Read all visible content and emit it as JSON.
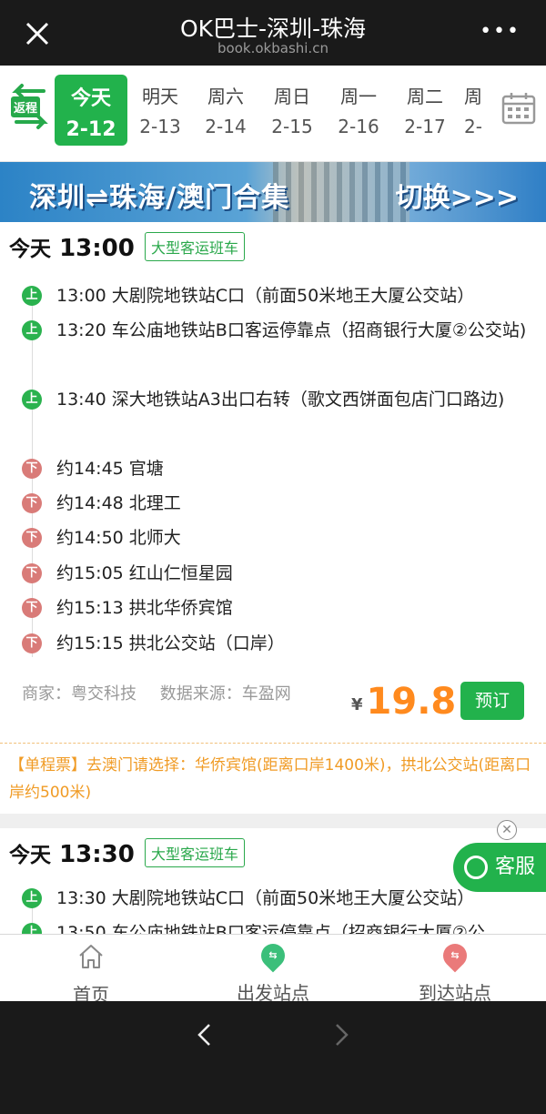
{
  "topbar": {
    "title": "OK巴士-深圳-珠海",
    "url": "book.okbashi.cn",
    "more": "•••"
  },
  "datebar": {
    "return_label": "返程",
    "days": [
      {
        "name": "今天",
        "date": "2-12",
        "active": true
      },
      {
        "name": "明天",
        "date": "2-13"
      },
      {
        "name": "周六",
        "date": "2-14"
      },
      {
        "name": "周日",
        "date": "2-15"
      },
      {
        "name": "周一",
        "date": "2-16"
      },
      {
        "name": "周二",
        "date": "2-17"
      },
      {
        "name": "周",
        "date": "2-"
      }
    ]
  },
  "banner": {
    "text": "深圳⇌珠海/澳门合集",
    "switch": "切换>>>"
  },
  "trips": [
    {
      "day": "今天",
      "time": "13:00",
      "tag": "大型客运班车",
      "stops": [
        {
          "type": "up",
          "icon": "上",
          "text": "13:00 大剧院地铁站C口（前面50米地王大厦公交站）"
        },
        {
          "type": "up",
          "icon": "上",
          "text": "13:20 车公庙地铁站B口客运停靠点（招商银行大厦②公交站)"
        },
        {
          "type": "up",
          "icon": "上",
          "text": "13:40 深大地铁站A3出口右转（歌文西饼面包店门口路边)"
        },
        {
          "type": "down",
          "icon": "下",
          "text": "约14:45 官塘"
        },
        {
          "type": "down",
          "icon": "下",
          "text": "约14:48 北理工"
        },
        {
          "type": "down",
          "icon": "下",
          "text": "约14:50 北师大"
        },
        {
          "type": "down",
          "icon": "下",
          "text": "约15:05 红山仁恒星园"
        },
        {
          "type": "down",
          "icon": "下",
          "text": "约15:13 拱北华侨宾馆"
        },
        {
          "type": "down",
          "icon": "下",
          "text": "约15:15 拱北公交站（口岸）"
        }
      ],
      "merchant": "商家：粤交科技",
      "source": "数据来源：车盈网",
      "currency": "¥",
      "price": "19.8",
      "book_label": "预订",
      "note": "【单程票】去澳门请选择：华侨宾馆(距离口岸1400米)，拱北公交站(距离口岸约500米)"
    },
    {
      "day": "今天",
      "time": "13:30",
      "tag": "大型客运班车",
      "stops": [
        {
          "type": "up",
          "icon": "上",
          "text": "13:30 大剧院地铁站C口（前面50米地王大厦公交站）"
        },
        {
          "type": "up",
          "icon": "上",
          "text": "13:50 车公庙地铁站B口客运停靠点（招商银行大厦②公"
        }
      ]
    }
  ],
  "float": {
    "close": "✕",
    "service_label": "客服"
  },
  "bottomnav": {
    "items": [
      {
        "label": "首页",
        "icon": "home-icon"
      },
      {
        "label": "出发站点",
        "icon": "departure-pin-icon"
      },
      {
        "label": "到达站点",
        "icon": "arrival-pin-icon"
      }
    ]
  },
  "colors": {
    "accent_green": "#22b24c",
    "down_red": "#d97b78",
    "price_orange": "#ff8a1e",
    "note_orange": "#f09b25"
  }
}
